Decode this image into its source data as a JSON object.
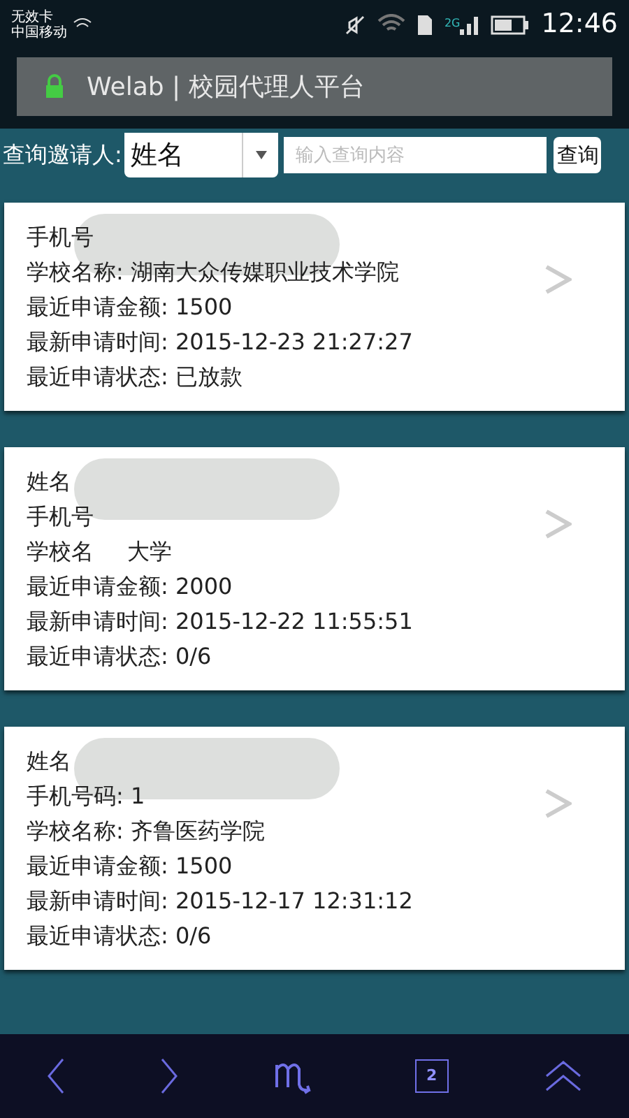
{
  "status_bar": {
    "sim_status": "无效卡",
    "carrier": "中国移动",
    "network": "2G",
    "time": "12:46"
  },
  "address_bar": {
    "title": "Welab | 校园代理人平台"
  },
  "search": {
    "label": "查询邀请人:",
    "dropdown_value": "姓名",
    "placeholder": "输入查询内容",
    "button": "查询"
  },
  "cards": [
    {
      "redacted": true,
      "lines": [
        {
          "text": "手机号"
        },
        {
          "text": "学校名称: 湖南大众传媒职业技术学院"
        },
        {
          "text": "最近申请金额: 1500"
        },
        {
          "text": "最新申请时间: 2015-12-23 21:27:27"
        },
        {
          "text": "最近申请状态: 已放款"
        }
      ]
    },
    {
      "redacted": true,
      "lines": [
        {
          "text": "姓名"
        },
        {
          "text": "手机号"
        },
        {
          "text": "学校名",
          "tail": "大学"
        },
        {
          "text": "最近申请金额: 2000"
        },
        {
          "text": "最新申请时间: 2015-12-22 11:55:51"
        },
        {
          "text": "最近申请状态: 0/6"
        }
      ]
    },
    {
      "redacted": true,
      "lines": [
        {
          "text": "姓名"
        },
        {
          "text": "手机号码: 1"
        },
        {
          "text": "学校名称: 齐鲁医药学院"
        },
        {
          "text": "最近申请金额: 1500"
        },
        {
          "text": "最新申请时间: 2015-12-17 12:31:12"
        },
        {
          "text": "最近申请状态: 0/6"
        }
      ]
    }
  ],
  "nav_bar": {
    "tab_count": "2"
  }
}
